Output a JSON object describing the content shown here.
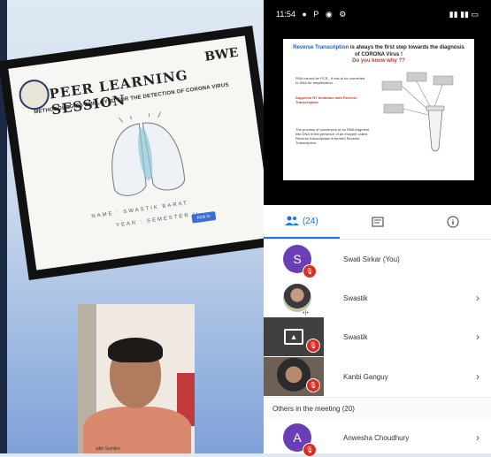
{
  "slide": {
    "title": "PEER LEARNING SESSION",
    "subtitle": "METHODOLOGIES EMPLOYED FOR THE DETECTION OF CORONA VIRUS",
    "brand": "BWE",
    "name_line": "NAME : SWASTIK BARAT",
    "year_line": "YEAR : SEMESTER II",
    "button_label": "Kick in"
  },
  "status_bar": {
    "time": "11:54",
    "icons_left": [
      "notification-icon",
      "p-icon",
      "whatsapp-icon",
      "settings-icon"
    ],
    "right": "4G ⅡⅡ"
  },
  "presentation": {
    "heading_blue": "Reverse Transcription",
    "heading_rest": " is always the first step towards the diagnosis of CORONA Virus !",
    "question": "Do you know why ??",
    "para1": "RNA cannot be PCR - it has to be converted to DNA for amplification",
    "para2": "Suppress RT inhibition with Reverse Transcriptase",
    "para3": "The process of conversion of an RNA fragment into DNA in the presence of an enzyme called Reverse transcriptase is termed Reverse Transcription."
  },
  "tabs": {
    "people_count": "(24)",
    "chat_label": "",
    "info_label": ""
  },
  "participants": [
    {
      "initial": "S",
      "name": "Swati Sirkar (You)",
      "type": "letter"
    },
    {
      "name": "Swastik",
      "type": "photo"
    },
    {
      "name": "Swastik",
      "type": "present"
    },
    {
      "name": "Kanbi Ganguy",
      "type": "cam"
    }
  ],
  "others_section": "Others in the meeting (20)",
  "others": [
    {
      "initial": "A",
      "name": "Anwesha Choudhury"
    }
  ],
  "webcam": {
    "caption": "sibh Sumitro"
  },
  "colors": {
    "accent": "#1a73e8",
    "avatar_purple": "#6a3fb5",
    "mute_red": "#d93025"
  }
}
